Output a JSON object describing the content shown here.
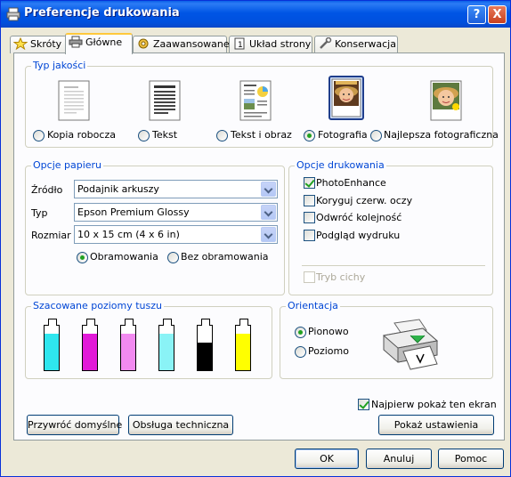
{
  "window": {
    "title": "Preferencje drukowania",
    "help_label": "?",
    "close_label": "X"
  },
  "tabs": [
    {
      "label": "Skróty"
    },
    {
      "label": "Główne"
    },
    {
      "label": "Zaawansowane"
    },
    {
      "label": "Układ strony"
    },
    {
      "label": "Konserwacja"
    }
  ],
  "quality": {
    "title": "Typ jakości",
    "options": [
      {
        "label": "Kopia robocza",
        "selected": false
      },
      {
        "label": "Tekst",
        "selected": false
      },
      {
        "label": "Tekst i obraz",
        "selected": false
      },
      {
        "label": "Fotografia",
        "selected": true
      },
      {
        "label": "Najlepsza fotograficzna",
        "selected": false
      }
    ]
  },
  "paper": {
    "title": "Opcje papieru",
    "source_label": "Źródło",
    "source_value": "Podajnik arkuszy",
    "type_label": "Typ",
    "type_value": "Epson Premium Glossy",
    "size_label": "Rozmiar",
    "size_value": "10 x 15 cm (4 x 6 in)",
    "border_label": "Obramowania",
    "borderless_label": "Bez obramowania",
    "border_selected": "Obramowania"
  },
  "print_options": {
    "title": "Opcje drukowania",
    "items": [
      {
        "label": "PhotoEnhance",
        "checked": true
      },
      {
        "label": "Koryguj czerw. oczy",
        "checked": false
      },
      {
        "label": "Odwróć kolejność",
        "checked": false
      },
      {
        "label": "Podgląd wydruku",
        "checked": false
      }
    ],
    "quiet_label": "Tryb cichy",
    "quiet_checked": false
  },
  "ink": {
    "title": "Szacowane poziomy tuszu",
    "levels": [
      {
        "name": "cyan",
        "color": "#2FE6EE",
        "level": 0.82
      },
      {
        "name": "magenta",
        "color": "#E21AD8",
        "level": 0.82
      },
      {
        "name": "light-magenta",
        "color": "#F28AF0",
        "level": 0.82
      },
      {
        "name": "light-cyan",
        "color": "#8AF3F6",
        "level": 0.82
      },
      {
        "name": "black",
        "color": "#000000",
        "level": 0.62
      },
      {
        "name": "yellow",
        "color": "#FFFF00",
        "level": 0.82
      }
    ]
  },
  "orientation": {
    "title": "Orientacja",
    "portrait_label": "Pionowo",
    "landscape_label": "Poziomo",
    "selected": "Pionowo"
  },
  "show_first_label": "Najpierw pokaż ten ekran",
  "show_first_checked": true,
  "buttons": {
    "restore": "Przywróć domyślne",
    "service": "Obsługa techniczna",
    "show_settings": "Pokaż ustawienia",
    "ok": "OK",
    "cancel": "Anuluj",
    "help": "Pomoc"
  },
  "colors": {
    "title_bar": "#0055E5",
    "group_label": "#0046D5",
    "check_mark": "#21A121"
  }
}
